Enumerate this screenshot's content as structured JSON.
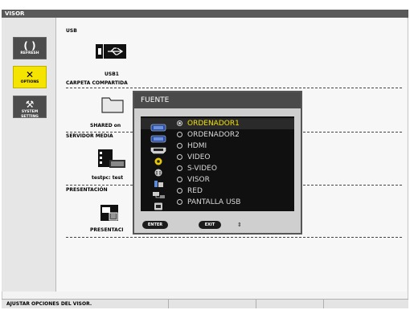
{
  "window": {
    "title": "VISOR"
  },
  "sidebar": {
    "items": [
      {
        "label": "REFRESH",
        "icon": "refresh-icon",
        "active": false
      },
      {
        "label": "OPTIONS",
        "icon": "tools-icon",
        "active": true
      },
      {
        "label": "SYSTEM SETTING",
        "icon": "system-setting-icon",
        "active": false
      }
    ]
  },
  "main": {
    "sections": [
      {
        "title": "USB",
        "item_label": "USB1",
        "icon": "usb-drive-icon"
      },
      {
        "title": "CARPETA COMPARTIDA",
        "item_label": "SHARED on",
        "icon": "folder-icon"
      },
      {
        "title": "SERVIDOR MEDIA",
        "item_label": "testpc: test",
        "icon": "media-server-icon"
      },
      {
        "title": "PRESENTACIÓN",
        "item_label": "PRESENTACI",
        "icon": "presentation-icon"
      }
    ]
  },
  "dialog": {
    "title": "FUENTE",
    "selected_index": 0,
    "sources": [
      {
        "label": "ORDENADOR1",
        "icon": "vga-icon"
      },
      {
        "label": "ORDENADOR2",
        "icon": "vga-icon"
      },
      {
        "label": "HDMI",
        "icon": "hdmi-icon"
      },
      {
        "label": "VIDEO",
        "icon": "video-icon"
      },
      {
        "label": "S-VIDEO",
        "icon": "svideo-icon"
      },
      {
        "label": "VISOR",
        "icon": "viewer-icon"
      },
      {
        "label": "RED",
        "icon": "network-icon"
      },
      {
        "label": "PANTALLA USB",
        "icon": "usb-display-icon"
      }
    ],
    "footer": {
      "enter": "ENTER",
      "exit": "EXIT",
      "updown": "⇕"
    }
  },
  "status_bar": {
    "text": "AJUSTAR OPCIONES DEL VISOR."
  },
  "colors": {
    "accent": "#f5e400",
    "selected_text": "#f0e000",
    "dark": "#101010"
  }
}
